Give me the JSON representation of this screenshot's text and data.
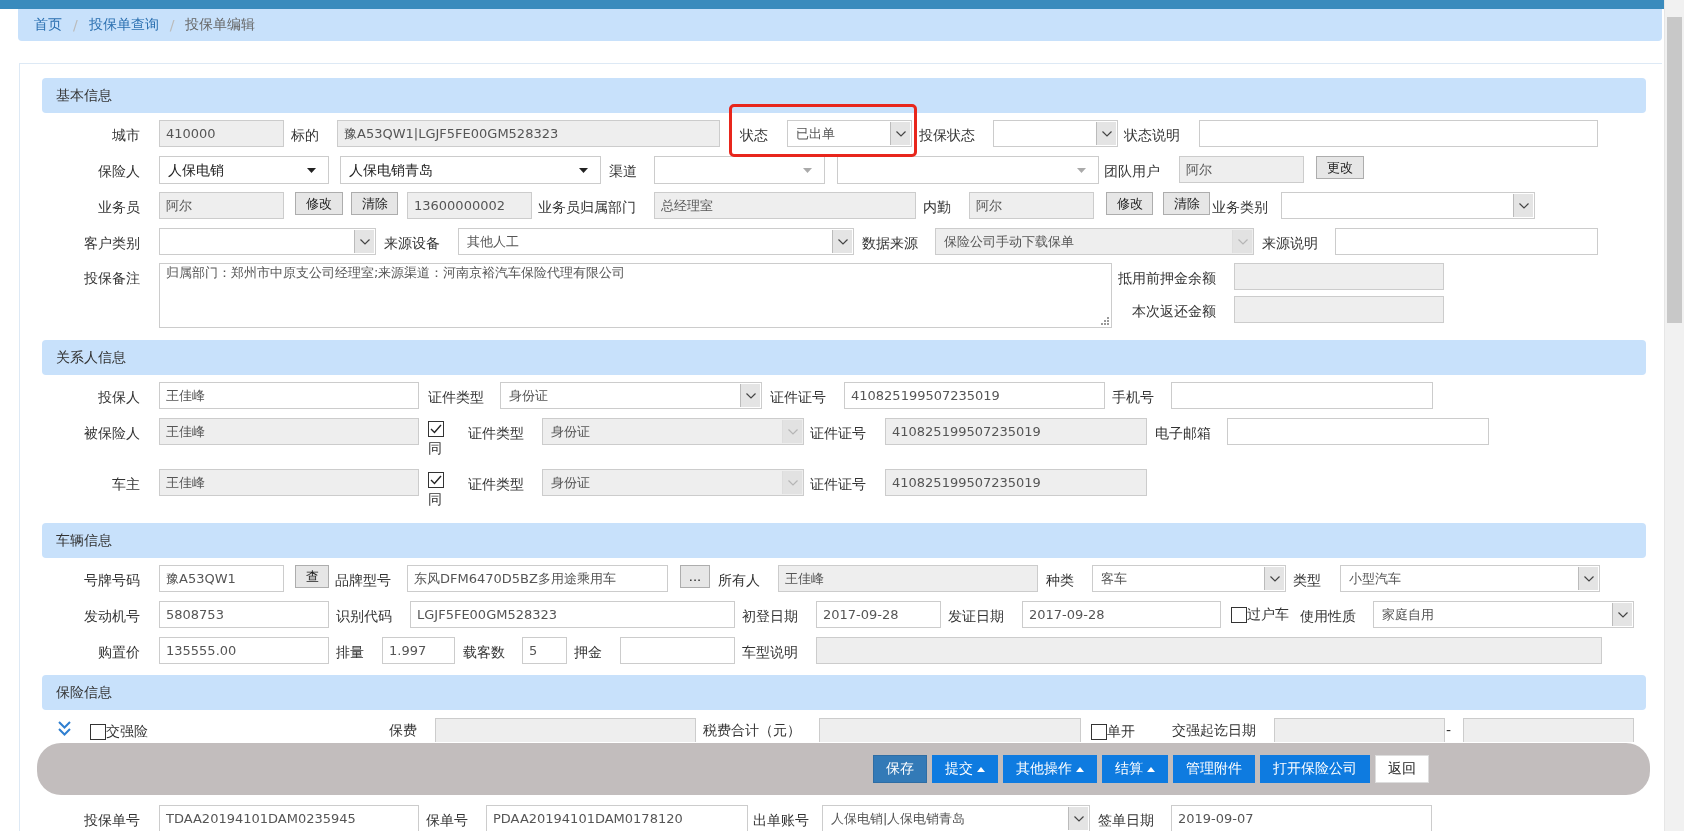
{
  "breadcrumb": [
    {
      "kind": "link",
      "text": "首页"
    },
    {
      "kind": "separator",
      "text": "/"
    },
    {
      "kind": "link",
      "text": "投保单查询"
    },
    {
      "kind": "separator",
      "text": "/"
    },
    {
      "kind": "current",
      "text": "投保单编辑"
    }
  ],
  "sections": [
    {
      "title": "基本信息",
      "rows": [
        {
          "items": [
            {
              "kind": "label",
              "text": "城市"
            },
            {
              "kind": "input",
              "value": "410000",
              "disabled": true
            },
            {
              "kind": "label",
              "text": "标的"
            },
            {
              "kind": "input",
              "value": "豫A53QW1|LGJF5FE00GM528323",
              "disabled": true
            },
            {
              "kind": "label",
              "text": "状态"
            },
            {
              "kind": "select",
              "value": "已出单",
              "disabled": false,
              "highlighted": true
            },
            {
              "kind": "label",
              "text": "投保状态"
            },
            {
              "kind": "select",
              "disabled": false
            },
            {
              "kind": "label",
              "text": "状态说明"
            },
            {
              "kind": "input",
              "disabled": false
            }
          ]
        },
        {
          "items": [
            {
              "kind": "label",
              "text": "保险人"
            },
            {
              "kind": "combo",
              "value": "人保电销"
            },
            {
              "kind": "combo",
              "value": "人保电销青岛"
            },
            {
              "kind": "label",
              "text": "渠道"
            },
            {
              "kind": "combo"
            },
            {
              "kind": "combo"
            },
            {
              "kind": "label",
              "text": "团队用户"
            },
            {
              "kind": "input",
              "value": "阿尔",
              "disabled": true
            },
            {
              "kind": "button",
              "text": "更改"
            }
          ]
        },
        {
          "items": [
            {
              "kind": "label",
              "text": "业务员"
            },
            {
              "kind": "input",
              "value": "阿尔",
              "disabled": true
            },
            {
              "kind": "button",
              "text": "修改"
            },
            {
              "kind": "button",
              "text": "清除"
            },
            {
              "kind": "input",
              "value": "13600000002",
              "disabled": true
            },
            {
              "kind": "label",
              "text": "业务员归属部门"
            },
            {
              "kind": "input",
              "value": "总经理室",
              "disabled": true
            },
            {
              "kind": "label",
              "text": "内勤"
            },
            {
              "kind": "input",
              "value": "阿尔",
              "disabled": true
            },
            {
              "kind": "button",
              "text": "修改"
            },
            {
              "kind": "button",
              "text": "清除"
            },
            {
              "kind": "label",
              "text": "业务类别"
            },
            {
              "kind": "select",
              "disabled": false
            }
          ]
        },
        {
          "items": [
            {
              "kind": "label",
              "text": "客户类别"
            },
            {
              "kind": "select",
              "disabled": false
            },
            {
              "kind": "label",
              "text": "来源设备"
            },
            {
              "kind": "select",
              "value": "其他人工",
              "disabled": false
            },
            {
              "kind": "label",
              "text": "数据来源"
            },
            {
              "kind": "select",
              "value": "保险公司手动下载保单",
              "disabled": true
            },
            {
              "kind": "label",
              "text": "来源说明"
            },
            {
              "kind": "input",
              "disabled": false
            }
          ]
        },
        {
          "items": [
            {
              "kind": "label",
              "text": "投保备注"
            },
            {
              "kind": "textarea",
              "value": "归属部门：郑州市中原支公司经理室;来源渠道：河南京裕汽车保险代理有限公司",
              "disabled": false
            },
            {
              "kind": "label",
              "text": "抵用前押金余额"
            },
            {
              "kind": "input",
              "disabled": true
            },
            {
              "kind": "label",
              "text": "本次返还金额"
            },
            {
              "kind": "input",
              "disabled": true
            }
          ]
        }
      ]
    },
    {
      "title": "关系人信息",
      "rows": [
        {
          "items": [
            {
              "kind": "label",
              "text": "投保人"
            },
            {
              "kind": "input",
              "value": "王佳峰",
              "disabled": false
            },
            {
              "kind": "label",
              "text": "证件类型"
            },
            {
              "kind": "select",
              "value": "身份证",
              "disabled": false
            },
            {
              "kind": "label",
              "text": "证件证号"
            },
            {
              "kind": "input",
              "value": "410825199507235019",
              "disabled": false
            },
            {
              "kind": "label",
              "text": "手机号"
            },
            {
              "kind": "input",
              "disabled": false
            }
          ]
        },
        {
          "items": [
            {
              "kind": "label",
              "text": "被保险人"
            },
            {
              "kind": "input",
              "value": "王佳峰",
              "disabled": true
            },
            {
              "kind": "check_stacked",
              "text": "同",
              "checked": true
            },
            {
              "kind": "label",
              "text": "证件类型"
            },
            {
              "kind": "select",
              "value": "身份证",
              "disabled": true
            },
            {
              "kind": "label",
              "text": "证件证号"
            },
            {
              "kind": "input",
              "value": "410825199507235019",
              "disabled": true
            },
            {
              "kind": "label",
              "text": "电子邮箱"
            },
            {
              "kind": "input",
              "disabled": false
            }
          ]
        },
        {
          "items": [
            {
              "kind": "label",
              "text": "车主"
            },
            {
              "kind": "input",
              "value": "王佳峰",
              "disabled": true
            },
            {
              "kind": "check_stacked",
              "text": "同",
              "checked": true
            },
            {
              "kind": "label",
              "text": "证件类型"
            },
            {
              "kind": "select",
              "value": "身份证",
              "disabled": true
            },
            {
              "kind": "label",
              "text": "证件证号"
            },
            {
              "kind": "input",
              "value": "410825199507235019",
              "disabled": true
            }
          ]
        }
      ]
    },
    {
      "title": "车辆信息",
      "rows": [
        {
          "items": [
            {
              "kind": "label",
              "text": "号牌号码"
            },
            {
              "kind": "input",
              "value": "豫A53QW1",
              "disabled": false
            },
            {
              "kind": "button",
              "text": "查"
            },
            {
              "kind": "label",
              "text": "品牌型号"
            },
            {
              "kind": "input",
              "value": "东风DFM6470D5BZ多用途乘用车",
              "disabled": false
            },
            {
              "kind": "button",
              "text": "..."
            },
            {
              "kind": "label",
              "text": "所有人"
            },
            {
              "kind": "input",
              "value": "王佳峰",
              "disabled": true
            },
            {
              "kind": "label",
              "text": "种类"
            },
            {
              "kind": "select",
              "value": "客车",
              "disabled": false
            },
            {
              "kind": "label",
              "text": "类型"
            },
            {
              "kind": "select",
              "value": "小型汽车",
              "disabled": false
            }
          ]
        },
        {
          "items": [
            {
              "kind": "label",
              "text": "发动机号"
            },
            {
              "kind": "input",
              "value": "5808753",
              "disabled": false
            },
            {
              "kind": "label",
              "text": "识别代码"
            },
            {
              "kind": "input",
              "value": "LGJF5FE00GM528323",
              "disabled": false
            },
            {
              "kind": "label",
              "text": "初登日期"
            },
            {
              "kind": "input",
              "value": "2017-09-28",
              "disabled": false
            },
            {
              "kind": "label",
              "text": "发证日期"
            },
            {
              "kind": "input",
              "value": "2017-09-28",
              "disabled": false
            },
            {
              "kind": "check",
              "text": "过户车",
              "checked": false
            },
            {
              "kind": "label",
              "text": "使用性质"
            },
            {
              "kind": "select",
              "value": "家庭自用",
              "disabled": false
            }
          ]
        },
        {
          "items": [
            {
              "kind": "label",
              "text": "购置价"
            },
            {
              "kind": "input",
              "value": "135555.00",
              "disabled": false
            },
            {
              "kind": "label",
              "text": "排量"
            },
            {
              "kind": "input",
              "value": "1.997",
              "disabled": false
            },
            {
              "kind": "label",
              "text": "载客数"
            },
            {
              "kind": "input",
              "value": "5",
              "disabled": false
            },
            {
              "kind": "label",
              "text": "押金"
            },
            {
              "kind": "input",
              "disabled": false
            },
            {
              "kind": "label",
              "text": "车型说明"
            },
            {
              "kind": "input",
              "disabled": true
            }
          ]
        }
      ]
    },
    {
      "title": "保险信息",
      "rows": [
        {
          "items": [
            {
              "kind": "expander"
            },
            {
              "kind": "check",
              "text": "交强险",
              "checked": false
            },
            {
              "kind": "label",
              "text": "保费"
            },
            {
              "kind": "input",
              "disabled": true
            },
            {
              "kind": "label",
              "text": "税费合计（元）"
            },
            {
              "kind": "input",
              "disabled": true
            },
            {
              "kind": "check",
              "text": "单开",
              "checked": false
            },
            {
              "kind": "label",
              "text": "交强起讫日期"
            },
            {
              "kind": "input",
              "disabled": true
            },
            {
              "kind": "label",
              "text": "-"
            },
            {
              "kind": "input",
              "disabled": true
            }
          ]
        },
        {
          "items": [
            {
              "kind": "label",
              "text": "投保单号"
            },
            {
              "kind": "input",
              "value": "TDAA20194101DAM0235945",
              "disabled": false
            },
            {
              "kind": "label",
              "text": "保单号"
            },
            {
              "kind": "input",
              "value": "PDAA20194101DAM0178120",
              "disabled": false
            },
            {
              "kind": "label",
              "text": "出单账号"
            },
            {
              "kind": "select",
              "value": "人保电销|人保电销青岛",
              "disabled": false
            },
            {
              "kind": "label",
              "text": "签单日期"
            },
            {
              "kind": "input",
              "value": "2019-09-07",
              "disabled": false
            }
          ]
        }
      ]
    }
  ],
  "action_bar": {
    "buttons": [
      {
        "text": "保存",
        "kind": "primary",
        "menu": false
      },
      {
        "text": "提交",
        "kind": "action",
        "menu": true
      },
      {
        "text": "其他操作",
        "kind": "action",
        "menu": true
      },
      {
        "text": "结算",
        "kind": "action",
        "menu": true
      },
      {
        "text": "管理附件",
        "kind": "action",
        "menu": false
      },
      {
        "text": "打开保险公司",
        "kind": "action",
        "menu": false
      },
      {
        "text": "返回",
        "kind": "plain",
        "menu": false
      }
    ]
  }
}
